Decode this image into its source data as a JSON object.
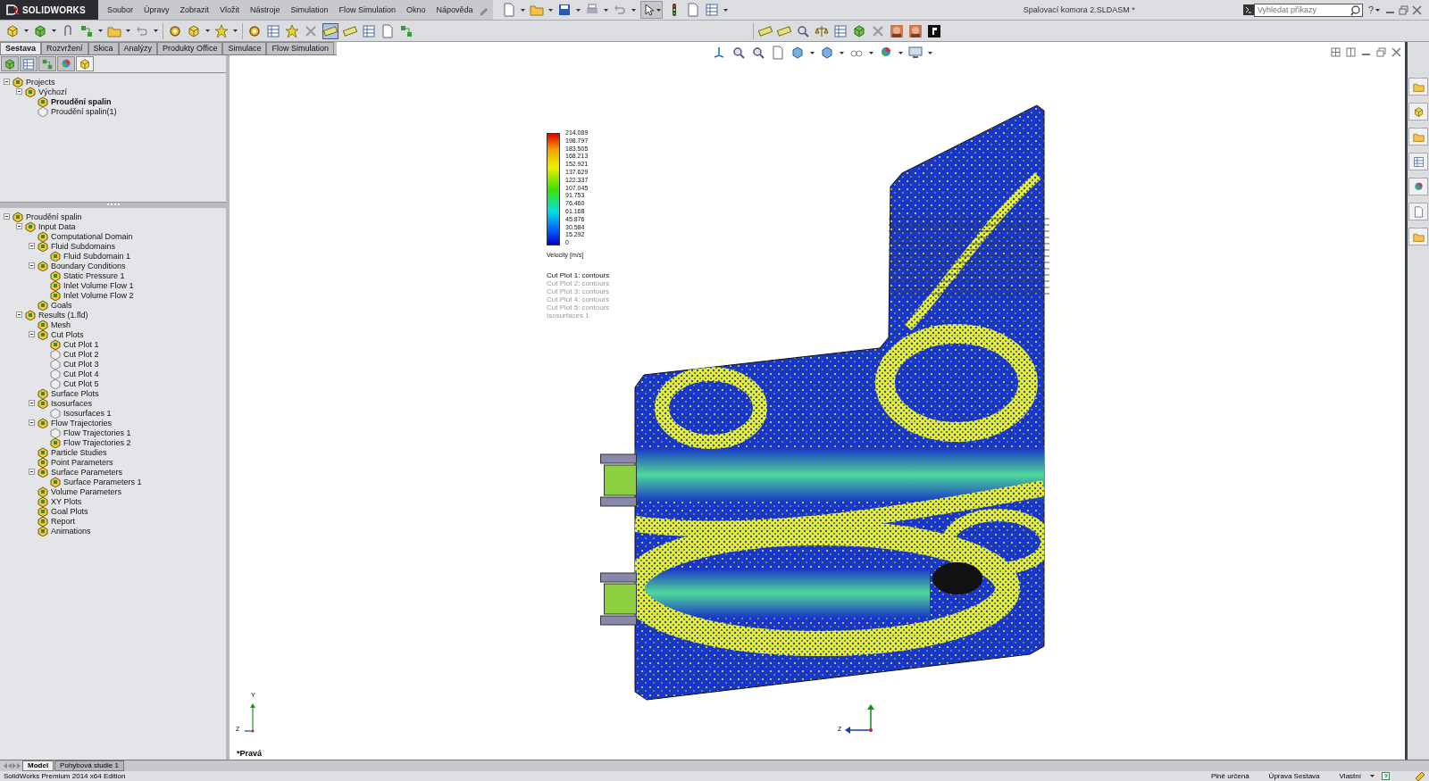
{
  "app": {
    "logo": "SOLIDWORKS",
    "menu": [
      "Soubor",
      "Úpravy",
      "Zobrazit",
      "Vložit",
      "Nástroje",
      "Simulation",
      "Flow Simulation",
      "Okno",
      "Nápověda"
    ],
    "title": "Spalovací komora 2.SLDASM *",
    "search": {
      "placeholder": "Vyhledat příkazy"
    },
    "help": "?"
  },
  "command_tabs": [
    {
      "label": "Sestava",
      "selected": true
    },
    {
      "label": "Rozvržení",
      "selected": false
    },
    {
      "label": "Skica",
      "selected": false
    },
    {
      "label": "Analýzy",
      "selected": false
    },
    {
      "label": "Produkty Office",
      "selected": false
    },
    {
      "label": "Simulace",
      "selected": false
    },
    {
      "label": "Flow Simulation",
      "selected": false
    }
  ],
  "projects_tree": [
    {
      "label": "Projects",
      "children": [
        {
          "label": "Výchozí",
          "children": [
            {
              "label": "Proudění spalin",
              "active": true,
              "hidden": false
            },
            {
              "label": "Proudění spalin(1)",
              "active": false,
              "hidden": true
            }
          ]
        }
      ]
    }
  ],
  "analysis_tree": [
    {
      "label": "Proudění spalin",
      "children": [
        {
          "label": "Input Data",
          "children": [
            {
              "label": "Computational Domain"
            },
            {
              "label": "Fluid Subdomains",
              "children": [
                {
                  "label": "Fluid Subdomain 1"
                }
              ]
            },
            {
              "label": "Boundary Conditions",
              "children": [
                {
                  "label": "Static Pressure 1"
                },
                {
                  "label": "Inlet Volume Flow 1"
                },
                {
                  "label": "Inlet Volume Flow 2"
                }
              ]
            },
            {
              "label": "Goals"
            }
          ]
        },
        {
          "label": "Results (1.fld)",
          "children": [
            {
              "label": "Mesh"
            },
            {
              "label": "Cut Plots",
              "children": [
                {
                  "label": "Cut Plot 1",
                  "hidden": false
                },
                {
                  "label": "Cut Plot 2",
                  "hidden": true
                },
                {
                  "label": "Cut Plot 3",
                  "hidden": true
                },
                {
                  "label": "Cut Plot 4",
                  "hidden": true
                },
                {
                  "label": "Cut Plot 5",
                  "hidden": true
                }
              ]
            },
            {
              "label": "Surface Plots"
            },
            {
              "label": "Isosurfaces",
              "children": [
                {
                  "label": "Isosurfaces 1",
                  "hidden": true
                }
              ]
            },
            {
              "label": "Flow Trajectories",
              "children": [
                {
                  "label": "Flow Trajectories 1",
                  "hidden": true
                },
                {
                  "label": "Flow Trajectories 2",
                  "hidden": false
                }
              ]
            },
            {
              "label": "Particle Studies"
            },
            {
              "label": "Point Parameters"
            },
            {
              "label": "Surface Parameters",
              "children": [
                {
                  "label": "Surface Parameters 1"
                }
              ]
            },
            {
              "label": "Volume Parameters"
            },
            {
              "label": "XY Plots"
            },
            {
              "label": "Goal Plots"
            },
            {
              "label": "Report"
            },
            {
              "label": "Animations"
            }
          ]
        }
      ]
    }
  ],
  "legend": {
    "ticks": [
      "214.089",
      "198.797",
      "183.505",
      "168.213",
      "152.921",
      "137.629",
      "122.337",
      "107.045",
      "91.753",
      "76.460",
      "61.168",
      "45.876",
      "30.584",
      "15.292",
      "0"
    ],
    "title": "Velocity [m/s]",
    "entries": [
      {
        "label": "Cut Plot 1: contours",
        "visible": true
      },
      {
        "label": "Cut Plot 2: contours",
        "visible": false
      },
      {
        "label": "Cut Plot 3: contours",
        "visible": false
      },
      {
        "label": "Cut Plot 4: contours",
        "visible": false
      },
      {
        "label": "Cut Plot 5: contours",
        "visible": false
      },
      {
        "label": "Isosurfaces 1",
        "visible": false
      }
    ]
  },
  "viewport": {
    "view_name": "*Pravá",
    "triad_labels": [
      "Y",
      "Z"
    ],
    "center_triad_label": "Z"
  },
  "bottom_tabs": [
    {
      "label": "Model",
      "selected": true
    },
    {
      "label": "Pohybová studie 1",
      "selected": false
    }
  ],
  "status_bar": {
    "product": "SolidWorks Premium 2014 x64 Edition",
    "fields": [
      "Plně určená",
      "Úprava Sestava",
      "Vlastní"
    ]
  }
}
